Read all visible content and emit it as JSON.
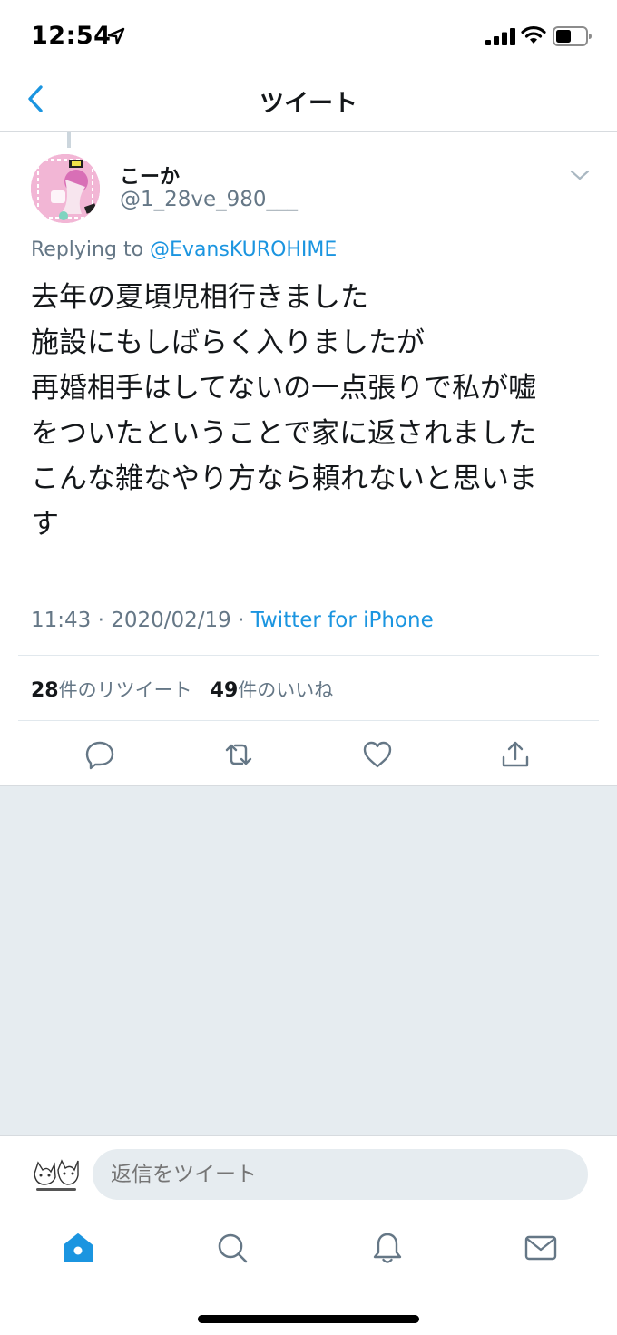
{
  "status_bar": {
    "time": "12:54"
  },
  "nav": {
    "title": "ツイート",
    "back_icon": "chevron-left-icon"
  },
  "tweet": {
    "display_name": "こーか",
    "handle": "@1_28ve_980___",
    "replying_prefix": "Replying to",
    "replying_to": "@EvansKUROHIME",
    "text_lines": [
      "去年の夏頃児相行きました",
      "施設にもしばらく入りましたが",
      "再婚相手はしてないの一点張りで私が嘘",
      "をついたということで家に返されました",
      "こんな雑なやり方なら頼れないと思いま",
      "す"
    ],
    "time": "11:43",
    "date": "2020/02/19",
    "separator": "·",
    "source": "Twitter for iPhone",
    "retweet_count": "28",
    "retweet_label": "件のリツイート",
    "like_count": "49",
    "like_label": "件のいいね"
  },
  "actions": [
    "reply-icon",
    "retweet-icon",
    "like-icon",
    "share-icon"
  ],
  "composer": {
    "placeholder": "返信をツイート"
  },
  "tab_bar": [
    "home-icon",
    "search-icon",
    "notifications-icon",
    "messages-icon"
  ],
  "colors": {
    "accent": "#1b95e0",
    "secondary_text": "#657786",
    "background_gray": "#e6ecf0"
  }
}
